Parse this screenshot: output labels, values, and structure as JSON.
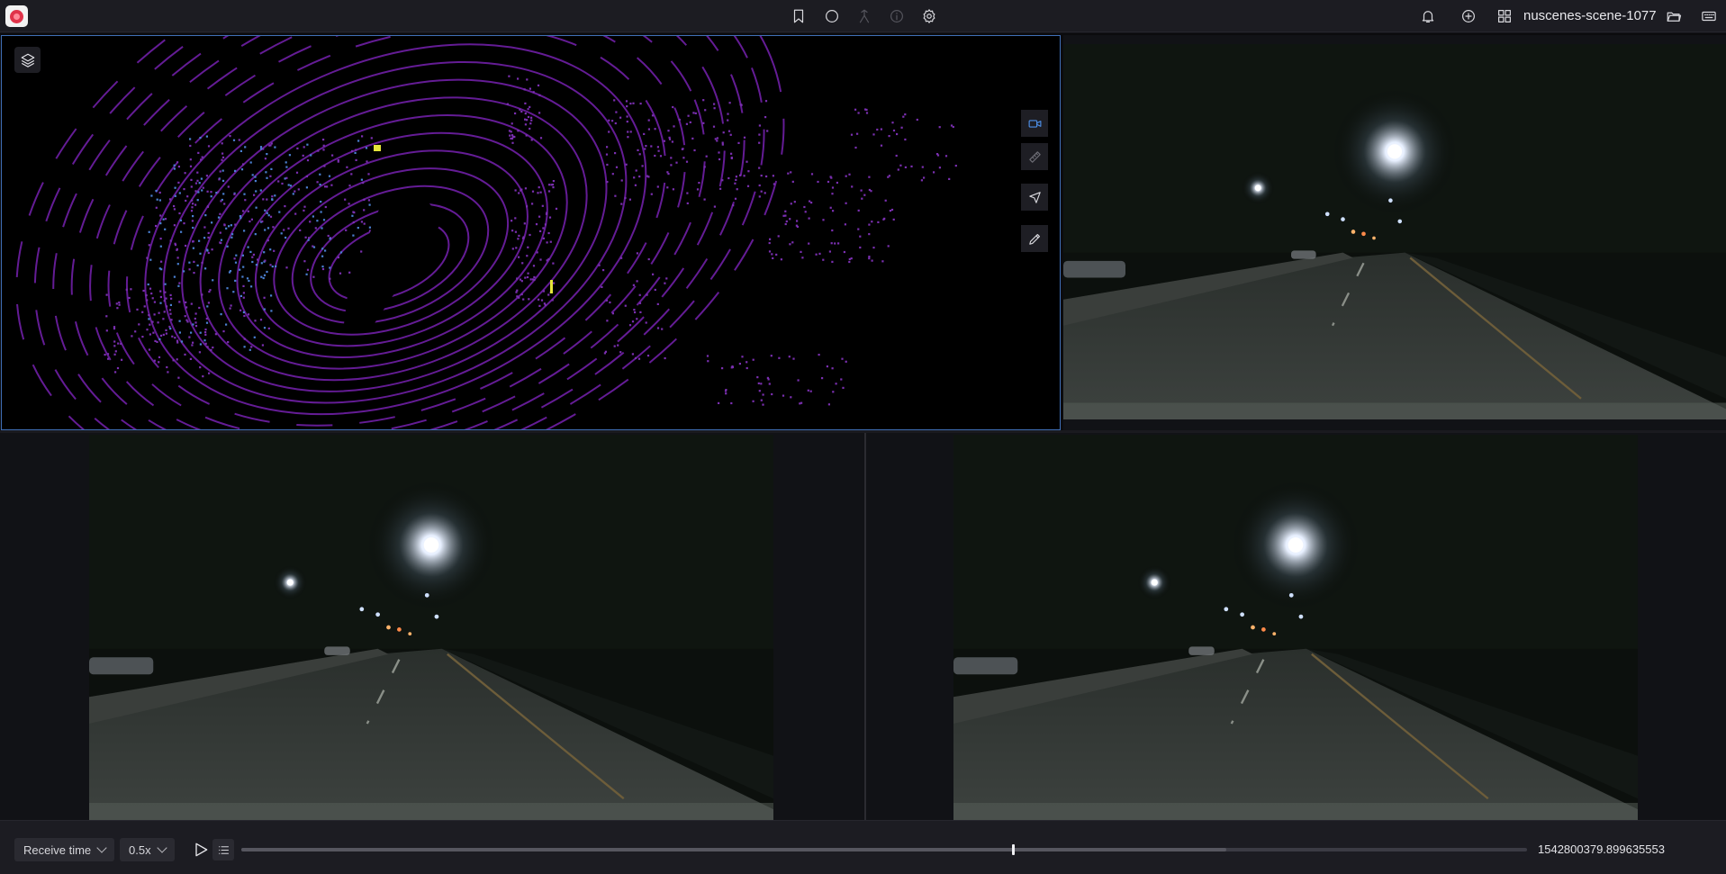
{
  "app": {
    "logo_icon": "foxglove-logo-icon",
    "layout_name": "nuscenes-scene-1077"
  },
  "toolbar_center": [
    {
      "name": "bookmark-icon",
      "enabled": true
    },
    {
      "name": "record-circle-icon",
      "enabled": true
    },
    {
      "name": "merge-icon",
      "enabled": false
    },
    {
      "name": "info-icon",
      "enabled": false
    },
    {
      "name": "gear-icon",
      "enabled": true
    }
  ],
  "toolbar_right": [
    {
      "name": "bell-icon"
    },
    {
      "name": "add-panel-icon"
    },
    {
      "name": "layout-icon"
    },
    {
      "name": "folder-open-icon"
    },
    {
      "name": "keyboard-icon"
    }
  ],
  "panel_3d": {
    "layers_icon": "layers-icon",
    "tools": [
      {
        "name": "camera-icon",
        "active": true
      },
      {
        "name": "ruler-icon",
        "active": false
      },
      {
        "name": "select-cursor-icon",
        "active": false
      },
      {
        "name": "pencil-icon",
        "active": false
      }
    ]
  },
  "playback": {
    "time_mode": "Receive time",
    "speed": "0.5x",
    "play_icon": "play-icon",
    "list_icon": "list-icon",
    "progress_fraction": 0.6,
    "buffered_fraction": 0.766,
    "timestamp": "1542800379.899635553"
  },
  "colors": {
    "accent": "#4d8fe8",
    "background": "#121217",
    "pointcloud": "#7a2fb0",
    "pointcloud_near": "#4a7fd0",
    "highlight": "#e6e63a"
  }
}
